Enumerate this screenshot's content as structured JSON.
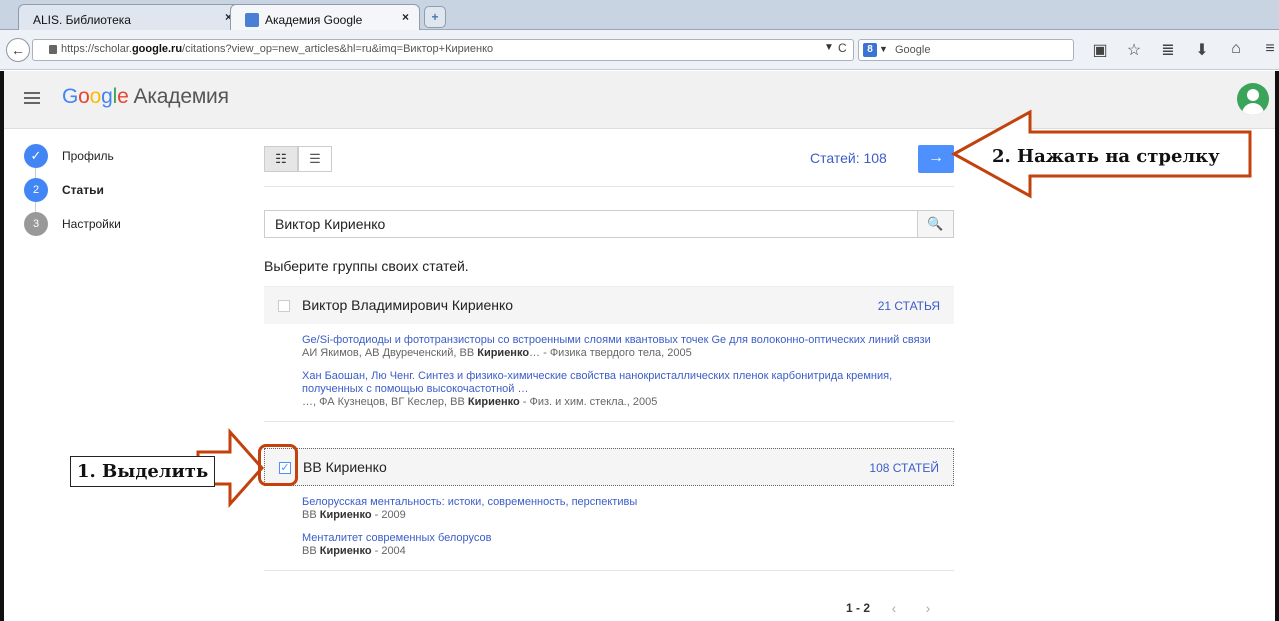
{
  "browser": {
    "tabs": [
      {
        "label": "ALIS. Библиотека",
        "active": false
      },
      {
        "label": "Академия Google",
        "active": true
      }
    ],
    "url_prefix": "https://scholar.",
    "url_domain": "google.ru",
    "url_path": "/citations?view_op=new_articles&hl=ru&imq=Виктор+Кириенко",
    "search_engine_letter": "8",
    "search_placeholder": "Google"
  },
  "header": {
    "logo_letters": [
      "G",
      "o",
      "o",
      "g",
      "l",
      "e"
    ],
    "logo_rest": "Академия"
  },
  "steps": [
    {
      "num": "✓",
      "label": "Профиль",
      "state": "done"
    },
    {
      "num": "2",
      "label": "Статьи",
      "state": "active"
    },
    {
      "num": "3",
      "label": "Настройки",
      "state": "todo"
    }
  ],
  "toolbar": {
    "articles_count": "Статей: 108",
    "next_arrow": "→"
  },
  "search": {
    "value": "Виктор Кириенко"
  },
  "choose_text": "Выберите группы своих статей.",
  "groups": [
    {
      "name": "Виктор Владимирович Кириенко",
      "count": "21 СТАТЬЯ",
      "checked": false,
      "articles": [
        {
          "title": "Ge/Si-фотодиоды и фототранзисторы со встроенными слоями квантовых точек Ge для волоконно-оптических линий связи",
          "authors_before": "АИ Якимов, АВ Двуреченский, ВВ ",
          "authors_bold": "Кириенко",
          "authors_after": "… - Физика твердого тела, 2005"
        },
        {
          "title": "Хан Баошан, Лю Ченг. Синтез и физико-химические свойства нанокристаллических пленок карбонитрида кремния, полученных с помощью высокочастотной …",
          "authors_before": "…, ФА Кузнецов, ВГ Кеслер, ВВ ",
          "authors_bold": "Кириенко",
          "authors_after": " - Физ. и хим. стекла., 2005"
        }
      ]
    },
    {
      "name": "ВВ Кириенко",
      "count": "108 СТАТЕЙ",
      "checked": true,
      "articles": [
        {
          "title": "Белорусская ментальность: истоки, современность, перспективы",
          "authors_before": "ВВ ",
          "authors_bold": "Кириенко",
          "authors_after": " - 2009"
        },
        {
          "title": "Менталитет современных белорусов",
          "authors_before": "ВВ ",
          "authors_bold": "Кириенко",
          "authors_after": " - 2004"
        }
      ]
    }
  ],
  "pager": {
    "range": "1 - 2",
    "prev": "‹",
    "next": "›"
  },
  "annotations": {
    "step1": "1. Выделить",
    "step2": "2. Нажать на стрелку",
    "arrow_color": "#c2410c"
  }
}
